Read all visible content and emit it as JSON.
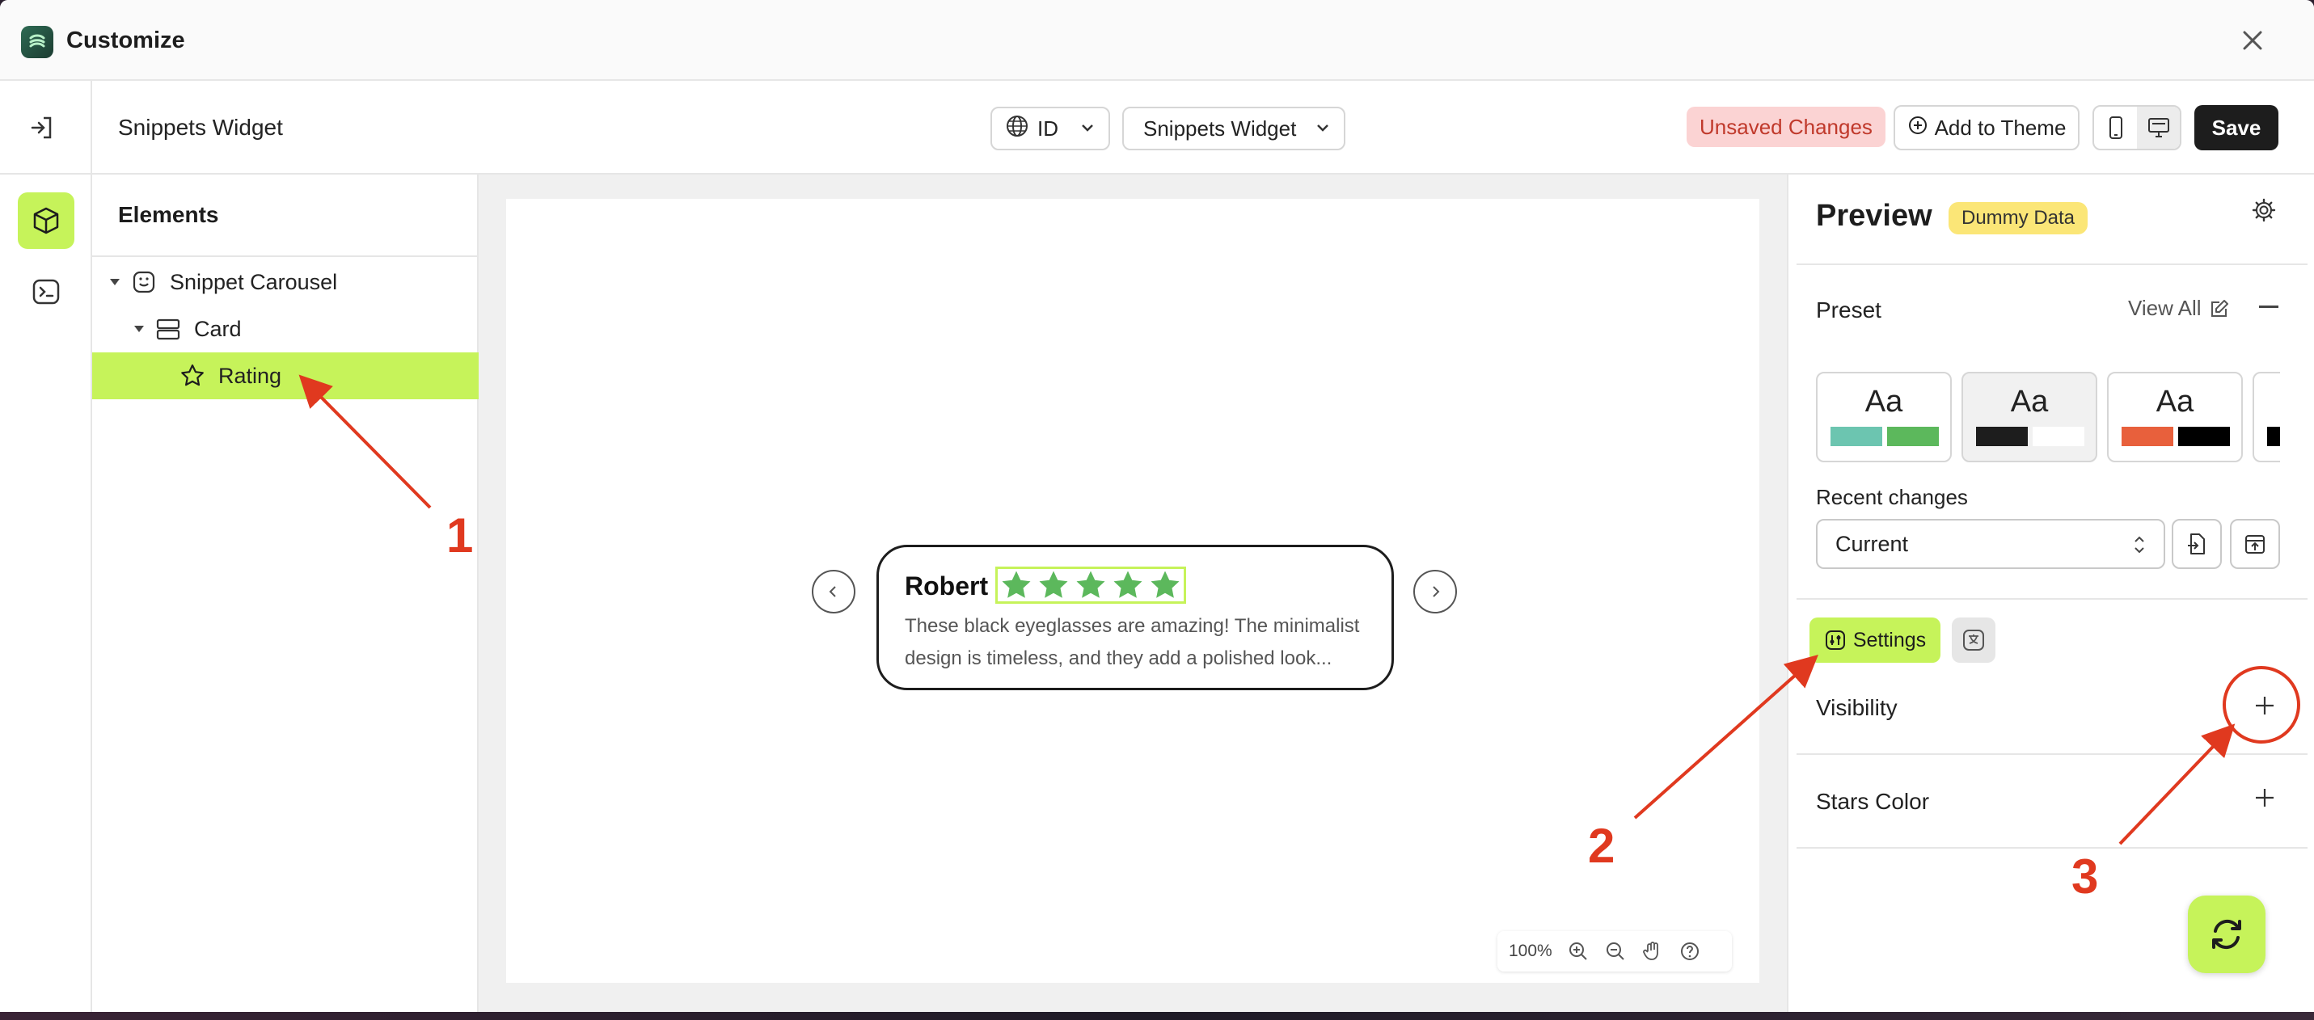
{
  "window": {
    "title": "Customize"
  },
  "toolbar": {
    "widget_name": "Snippets Widget",
    "language": "ID",
    "widget_select": "Snippets Widget",
    "unsaved": "Unsaved Changes",
    "add_to_theme": "Add to Theme",
    "save": "Save"
  },
  "elements": {
    "title": "Elements",
    "tree": [
      {
        "label": "Snippet Carousel",
        "icon": "carousel-icon"
      },
      {
        "label": "Card",
        "icon": "card-icon"
      },
      {
        "label": "Rating",
        "icon": "star-icon",
        "selected": true
      }
    ]
  },
  "canvas": {
    "card": {
      "name": "Robert",
      "rating": 5,
      "text": "These black eyeglasses are amazing! The minimalist design is timeless, and they add a polished look..."
    },
    "zoom": "100%"
  },
  "preview": {
    "title": "Preview",
    "badge": "Dummy Data",
    "preset_label": "Preset",
    "view_all": "View All",
    "presets": [
      {
        "label": "Aa",
        "colors": [
          "#6cc5b0",
          "#5cb85c"
        ]
      },
      {
        "label": "Aa",
        "colors": [
          "#1d1d1d",
          "#ffffff"
        ],
        "active": true
      },
      {
        "label": "Aa",
        "colors": [
          "#e8603c",
          "#000000"
        ]
      },
      {
        "label": "Aa",
        "colors": [
          "#000000"
        ]
      }
    ],
    "recent_label": "Recent changes",
    "recent_value": "Current",
    "settings_tab": "Settings",
    "sections": [
      "Visibility",
      "Stars Color"
    ]
  },
  "annotations": [
    "1",
    "2",
    "3"
  ],
  "colors": {
    "accent": "#c6f35a",
    "star": "#5cb85c",
    "annotation": "#e0391f",
    "unsaved_bg": "#fbd3d3",
    "dummy_bg": "#fbe677"
  }
}
